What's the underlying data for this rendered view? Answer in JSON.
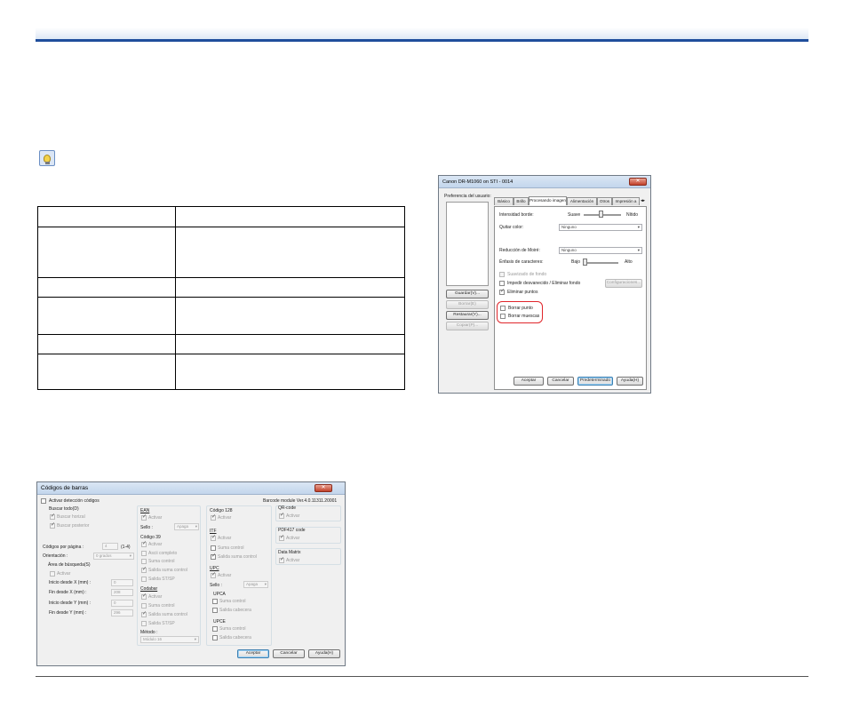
{
  "table": {
    "rows": 7
  },
  "dialog_right": {
    "title": "Canon DR-M1060 on STI - 0014",
    "user_pref_label": "Preferencia del usuario:",
    "tabs": [
      "Básico",
      "Brillo",
      "Procesando imagen",
      "Alimentación",
      "Otros",
      "Impresión a"
    ],
    "left_buttons": [
      "Guardar(V)...",
      "Borrar(E)",
      "Restaurar(Y)...",
      "Copiar(P)..."
    ],
    "intensidad_label": "Intensidad borde:",
    "suave": "Suave",
    "nitido": "Nítido",
    "quitar_color_label": "Quitar color:",
    "quitar_color_value": "Ninguno",
    "moire_label": "Reducción de Moiré:",
    "moire_value": "Ninguno",
    "enfasis_label": "Énfasis de caracteres:",
    "bajo": "Bajo",
    "alto": "Alto",
    "suavizado": "Suavizado de fondo",
    "impedir": "Impedir desvanecido / Eliminar fondo",
    "configuraciones": "Configuraciones...",
    "eliminar_puntos": "Eliminar puntos",
    "borrar_punto": "Borrar punto",
    "borrar_muescas": "Borrar muescas",
    "buttons": [
      "Aceptar",
      "Cancelar",
      "Predeterminado",
      "Ayuda(H)"
    ]
  },
  "dialog_barcode": {
    "title": "Códigos de barras",
    "close": "✕",
    "activar_deteccion": "Activar detección códigos",
    "module_version": "Barcode module Ver.4.0.11311.20001",
    "buscar_todo": "Buscar todo(D)",
    "buscar_horizontal": "Buscar horizal",
    "buscar_posterior": "Buscar posterior",
    "codigos_por_pagina": "Códigos por página :",
    "codigos_value": "4",
    "codigos_range": "(1-4)",
    "orientacion": "Orientación :",
    "orientacion_value": "0 grados",
    "area_busqueda": "Área de búsqueda(S)",
    "activar": "Activar",
    "inicio_x": "Inicio desde X (mm) :",
    "inicio_x_value": "0",
    "fin_x": "Fin desde X (mm) :",
    "fin_x_value": "208",
    "inicio_y": "Inicio desde Y (mm) :",
    "inicio_y_value": "0",
    "fin_y": "Fin desde Y (mm) :",
    "fin_y_value": "296",
    "ean": "EAN",
    "sello": "Sello :",
    "apaga": "Apaga",
    "code39": "Código 39",
    "ascii_completo": "Ascii completo",
    "suma_control": "Suma control",
    "salida_suma_control": "Salida suma control",
    "salida_st_sp": "Salida ST/SP",
    "codabar": "Codabar",
    "metodo": "Método :",
    "metodo_value": "Módulo 16",
    "code128": "Código 128",
    "itf": "ITF",
    "upc": "UPC",
    "upca": "UPCA",
    "upce": "UPCE",
    "salida_cabecera": "Salida cabecera",
    "qr": "QR-code",
    "pdf417": "PDF417 code",
    "datamatrix": "Data Matrix",
    "buttons": [
      "Aceptar",
      "Cancelar",
      "Ayuda(H)"
    ]
  }
}
